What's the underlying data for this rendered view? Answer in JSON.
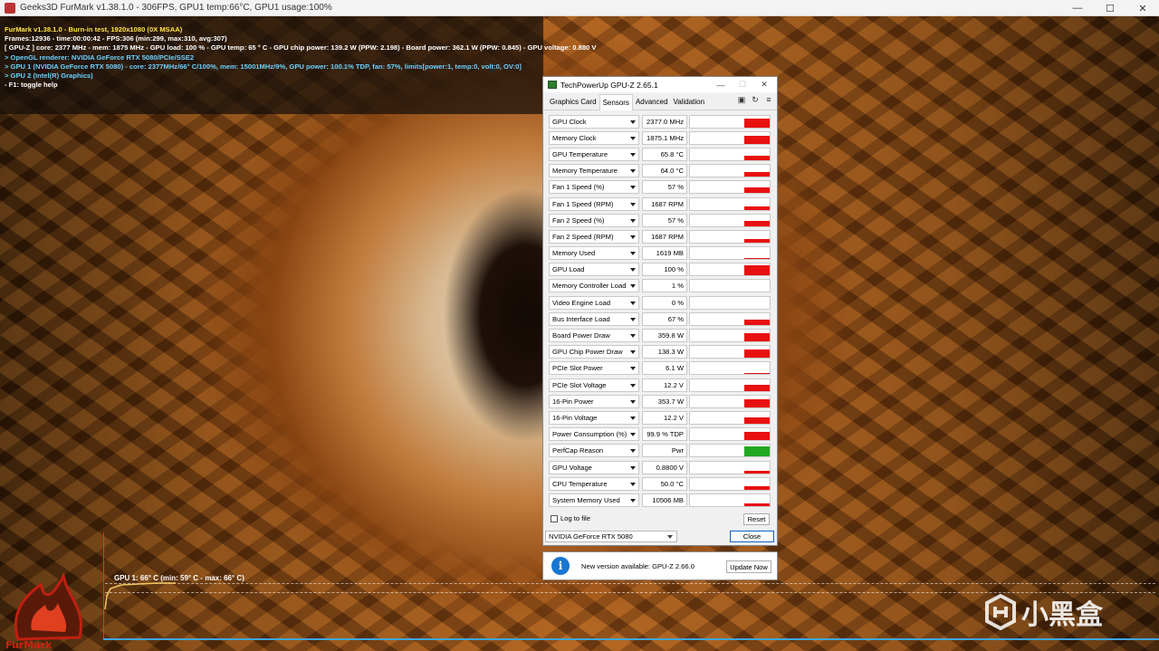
{
  "window": {
    "title": "Geeks3D FurMark v1.38.1.0 - 306FPS, GPU1 temp:66°C, GPU1 usage:100%",
    "minimize": "—",
    "maximize": "☐",
    "close": "✕"
  },
  "hud": {
    "line1": "FurMark v1.38.1.0 - Burn-in test, 1920x1080 (0X MSAA)",
    "line2": "Frames:12936 - time:00:00:42 - FPS:306 (min:299, max:310, avg:307)",
    "line3": "[ GPU-Z ] core: 2377 MHz - mem: 1875 MHz - GPU load: 100 % - GPU temp: 65 ° C - GPU chip power: 139.2 W (PPW: 2.198) - Board power: 362.1 W (PPW: 0.845) - GPU voltage: 0.880 V",
    "line4": "> OpenGL renderer: NVIDIA GeForce RTX 5080/PCIe/SSE2",
    "line5": "> GPU 1 (NVIDIA GeForce RTX 5080) - core: 2377MHz/66° C/100%, mem: 15001MHz/9%, GPU power: 100.1% TDP, fan: 57%, limits[power:1, temp:0, volt:0, OV:0]",
    "line6": "> GPU 2 (Intel(R) Graphics)",
    "line7": "- F1: toggle help"
  },
  "temp_graph": {
    "label": "GPU 1: 66° C (min: 59° C - max: 66° C)"
  },
  "gpuz": {
    "title": "TechPowerUp GPU-Z 2.65.1",
    "tabs": [
      "Graphics Card",
      "Sensors",
      "Advanced",
      "Validation"
    ],
    "active_tab": "Sensors",
    "tab_icons": [
      "camera-icon",
      "refresh-icon",
      "menu-icon"
    ],
    "sensors": [
      {
        "name": "GPU Clock",
        "value": "2377.0 MHz",
        "level": 0.95,
        "color": "#e81010"
      },
      {
        "name": "Memory Clock",
        "value": "1875.1 MHz",
        "level": 0.8,
        "color": "#e81010"
      },
      {
        "name": "GPU Temperature",
        "value": "65.8 °C",
        "level": 0.45,
        "color": "#e81010"
      },
      {
        "name": "Memory Temperature",
        "value": "64.0 °C",
        "level": 0.45,
        "color": "#e81010"
      },
      {
        "name": "Fan 1 Speed (%)",
        "value": "57 %",
        "level": 0.55,
        "color": "#e81010"
      },
      {
        "name": "Fan 1 Speed (RPM)",
        "value": "1687 RPM",
        "level": 0.4,
        "color": "#e81010"
      },
      {
        "name": "Fan 2 Speed (%)",
        "value": "57 %",
        "level": 0.55,
        "color": "#e81010"
      },
      {
        "name": "Fan 2 Speed (RPM)",
        "value": "1687 RPM",
        "level": 0.4,
        "color": "#e81010"
      },
      {
        "name": "Memory Used",
        "value": "1619 MB",
        "level": 0.1,
        "color": "#e81010"
      },
      {
        "name": "GPU Load",
        "value": "100 %",
        "level": 1.0,
        "color": "#e81010"
      },
      {
        "name": "Memory Controller Load",
        "value": "1 %",
        "level": 0.0,
        "color": "#e81010"
      },
      {
        "name": "Video Engine Load",
        "value": "0 %",
        "level": 0.0,
        "color": "#e81010"
      },
      {
        "name": "Bus Interface Load",
        "value": "67 %",
        "level": 0.55,
        "color": "#e81010"
      },
      {
        "name": "Board Power Draw",
        "value": "359.8 W",
        "level": 0.85,
        "color": "#e81010"
      },
      {
        "name": "GPU Chip Power Draw",
        "value": "138.3 W",
        "level": 0.85,
        "color": "#e81010"
      },
      {
        "name": "PCIe Slot Power",
        "value": "6.1 W",
        "level": 0.08,
        "color": "#e81010"
      },
      {
        "name": "PCIe Slot Voltage",
        "value": "12.2 V",
        "level": 0.6,
        "color": "#e81010"
      },
      {
        "name": "16-Pin Power",
        "value": "353.7 W",
        "level": 0.8,
        "color": "#e81010"
      },
      {
        "name": "16-Pin Voltage",
        "value": "12.2 V",
        "level": 0.6,
        "color": "#e81010"
      },
      {
        "name": "Power Consumption (%)",
        "value": "99.9 % TDP",
        "level": 0.85,
        "color": "#e81010"
      },
      {
        "name": "PerfCap Reason",
        "value": "Pwr",
        "level": 1.0,
        "color": "#22a822"
      },
      {
        "name": "GPU Voltage",
        "value": "0.8800 V",
        "level": 0.3,
        "color": "#e81010"
      },
      {
        "name": "CPU Temperature",
        "value": "50.0 °C",
        "level": 0.4,
        "color": "#e81010"
      },
      {
        "name": "System Memory Used",
        "value": "10506 MB",
        "level": 0.3,
        "color": "#e81010"
      }
    ],
    "log_to_file": "Log to file",
    "reset": "Reset",
    "gpu_select": "NVIDIA GeForce RTX 5080",
    "close": "Close"
  },
  "update_banner": {
    "icon": "i",
    "message": "New version available: GPU-Z 2.66.0",
    "button": "Update Now"
  },
  "watermark": {
    "text": "小黑盒"
  },
  "fm_logo": {
    "text": "FurMark"
  }
}
